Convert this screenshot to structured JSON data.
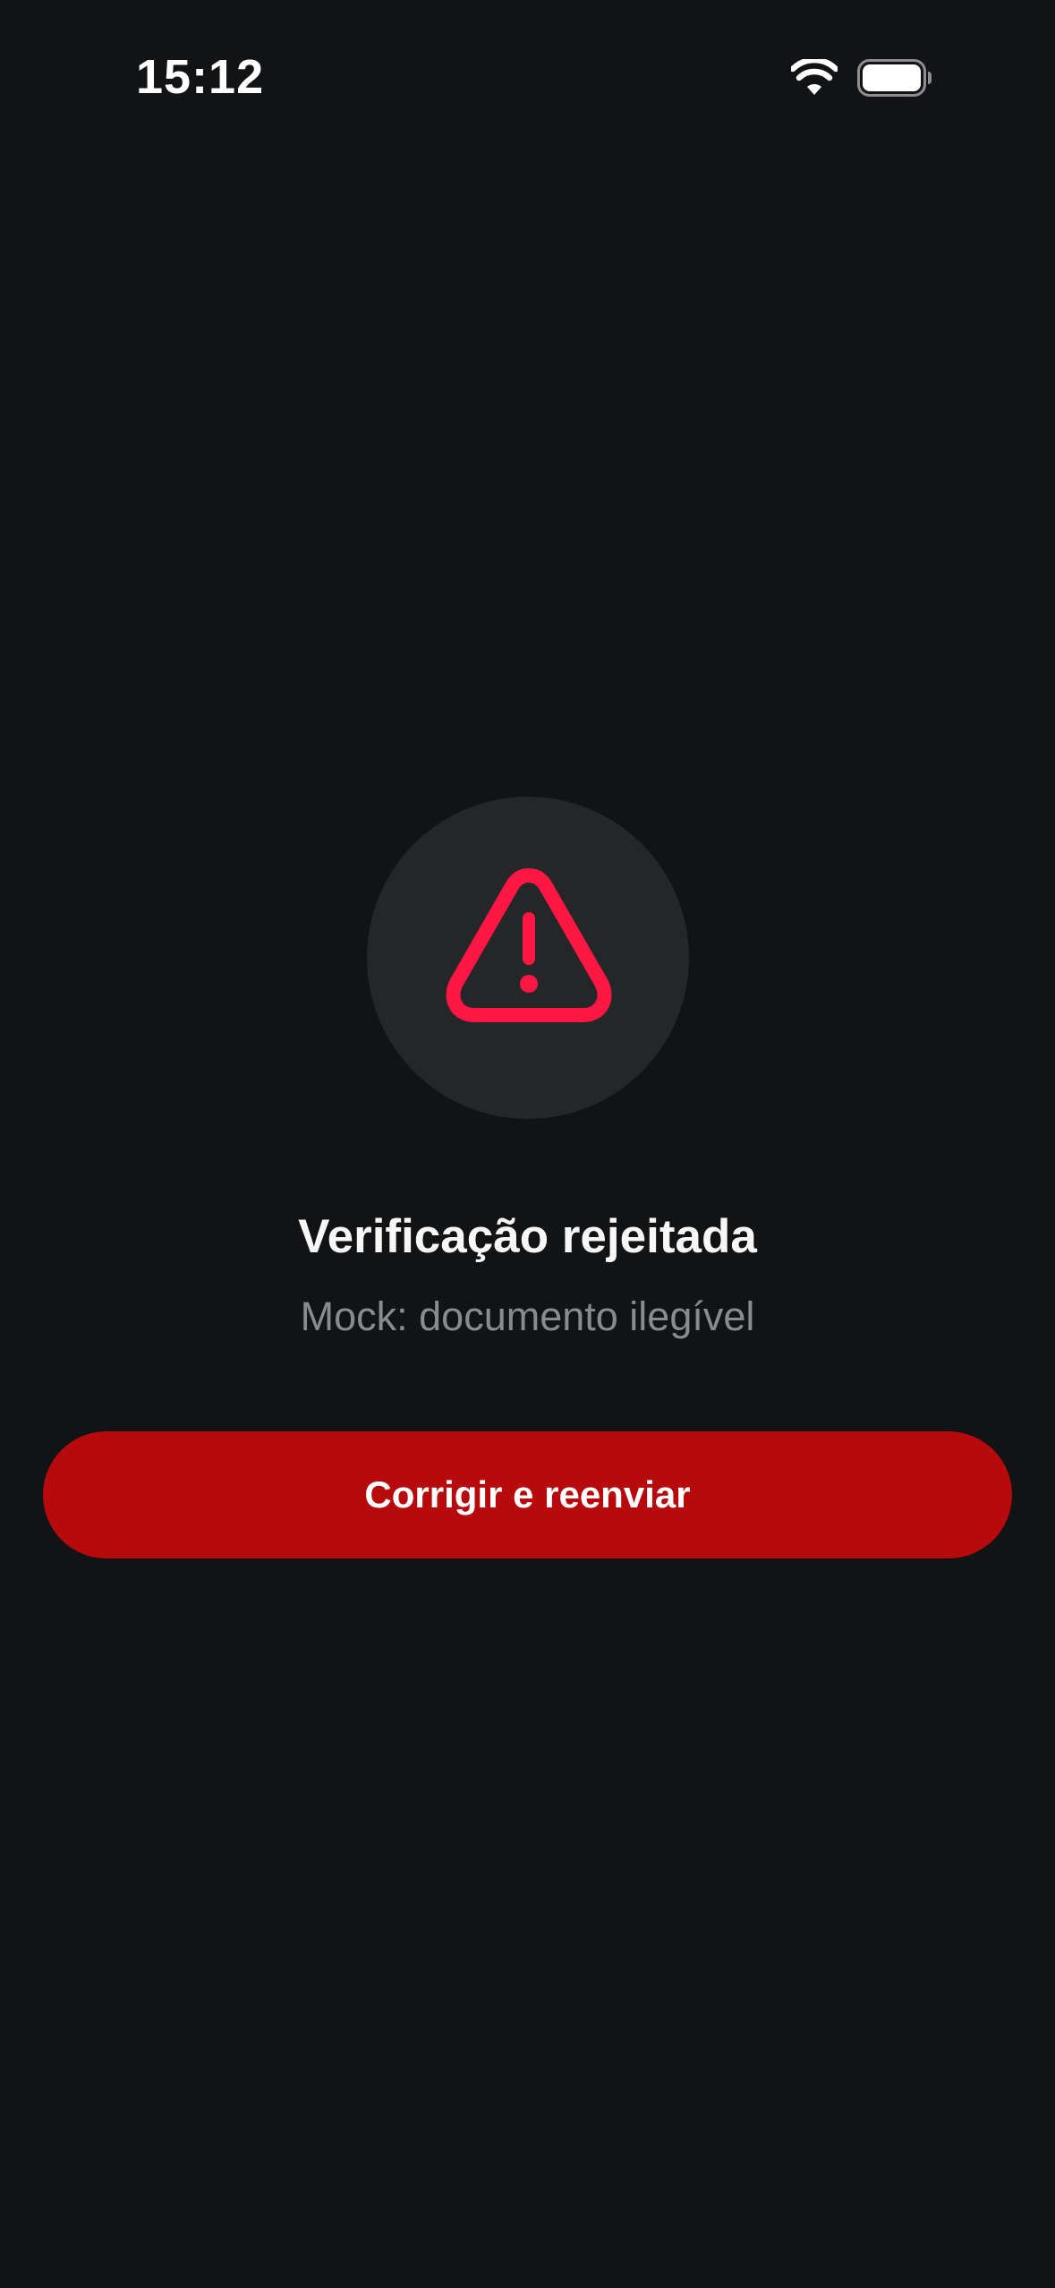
{
  "status_bar": {
    "time": "15:12",
    "wifi_icon": "wifi-icon",
    "battery_icon": "battery-icon"
  },
  "main": {
    "icon": "warning-triangle-icon",
    "icon_color": "#FF1744",
    "title": "Verificação rejeitada",
    "subtitle": "Mock: documento ilegível",
    "primary_button_label": "Corrigir e reenviar",
    "primary_button_color": "#B70A0D"
  }
}
